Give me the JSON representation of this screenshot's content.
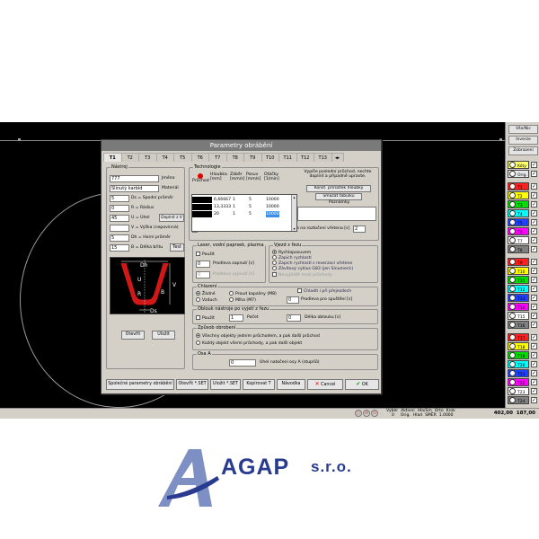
{
  "dialog": {
    "title": "Parametry obrábění",
    "tabs": [
      "T1",
      "T2",
      "T3",
      "T4",
      "T5",
      "T6",
      "T7",
      "T8",
      "T9",
      "T10",
      "T11",
      "T12",
      "T13"
    ],
    "active_tab": "T1"
  },
  "tool": {
    "group_title": "Nástroj",
    "name_value": "777",
    "name_label": "Jméno",
    "material_value": "Slinutý karbid",
    "material_label": "Materiál",
    "ds_value": "5",
    "ds_label": "Ds = Spodní průměr",
    "r_value": "0",
    "r_label": "R = Rádius",
    "u_value": "45",
    "u_label": "U = Úhel",
    "u_button": "Doplnit z V",
    "v_value": "",
    "v_label": "V = Výška (nepovinná)",
    "dh_value": "5",
    "dh_label": "Dh = Horní průměr",
    "b_value": "15",
    "b_label": "B = Délka břitu",
    "test_button": "Test",
    "diagram_labels": [
      "Dh",
      "U",
      "V",
      "R",
      "B",
      "Ds"
    ],
    "open_button": "Otevřít",
    "save_button": "Uložit"
  },
  "technology": {
    "group_title": "Technologie",
    "col_prechod": "Průchod",
    "col_hloubka": "Hloubka [mm]",
    "col_zaber": "Záběr [mm/s]",
    "col_posuv": "Posuv [mm/s]",
    "col_otacky": "Otáčky [1/min]",
    "rows": [
      {
        "hloubka": "6,66667",
        "zaber": "1",
        "posuv": "5",
        "otacky": "10000"
      },
      {
        "hloubka": "13,3333",
        "zaber": "1",
        "posuv": "5",
        "otacky": "10000"
      },
      {
        "hloubka": "20",
        "zaber": "1",
        "posuv": "5",
        "otacky": "10000"
      }
    ],
    "last_pass_text": "Vypíše poslední průchod, nechte doplnit a případně upravte.",
    "construct_button": "Konst. přírůstek hloubky",
    "clear_button": "Smazat tabulku",
    "notes_label": "Poznámky",
    "rapid_depth_value": "0",
    "rapid_depth_label": "Hloubka rychloposuvem",
    "spindle_delay_label": "Prodleva na roztočení vřetena [s]",
    "spindle_delay_value": "2"
  },
  "laser": {
    "group_title": "Laser, vodní paprsek, plazma",
    "use_label": "Použít",
    "on_delay_value": "0",
    "on_delay_label": "Prodleva zapnutí [s]",
    "off_delay_value": "0",
    "off_delay_label": "Prodleva vypnutí [s]"
  },
  "entry": {
    "group_title": "Vjezd z řezu",
    "options": [
      "Rychloposuvem",
      "Zapich rychlostí",
      "Zapich rychlostí s reverzací vřetene",
      "Závitový cyklus G83 (jen Sinumeric)"
    ],
    "selected": "Rychloposuvem",
    "disabled_label": "Nevyjíždět mezi průchody"
  },
  "cooling": {
    "group_title": "Chlazení",
    "options": [
      "Žádné",
      "Proud kapaliny (M8)",
      "Vzduch",
      "Mlha (M7)"
    ],
    "selected": "Žádné",
    "cool_transit_label": "Chladit i při přejezdech",
    "stop_delay_value": "0",
    "stop_delay_label": "Prodleva pro spuštění [s]"
  },
  "arc": {
    "group_title": "Oblouk nástroje po vyjetí z řezu",
    "use_label": "Použít",
    "count_value": "1",
    "count_label": "Počet",
    "length_value": "0",
    "length_label": "Délka oblouku [s]"
  },
  "processing": {
    "group_title": "Způsob obrobení",
    "options": [
      "Všechny objekty jedním průchodem, a pak další průchod",
      "Každý objekt všemi průchody, a pak další objekt"
    ],
    "selected": "Všechny objekty jedním průchodem, a pak další průchod"
  },
  "axis_a": {
    "group_title": "Osa A",
    "value": "0",
    "label": "Úhel natočení osy A (stupňů)"
  },
  "footer": {
    "common_button": "Společné parametry obrábění",
    "open_set_button": "Otevřít *.SET",
    "save_set_button": "Uložit *.SET",
    "copy_button": "Kopírovat T",
    "help_button": "Návodka",
    "cancel_button": "Cancel",
    "ok_button": "OK"
  },
  "right_panel": {
    "all_none": "Vše/Nic",
    "invert": "Inverze",
    "display": "Zobrazení",
    "layers": [
      {
        "label": "Kóty",
        "color": "#ffff66"
      },
      {
        "label": "Orig.",
        "color": "#e8e8e8"
      },
      {
        "label": "T1",
        "color": "#ff2020"
      },
      {
        "label": "T2",
        "color": "#ffff00"
      },
      {
        "label": "T3",
        "color": "#00e000"
      },
      {
        "label": "T4",
        "color": "#00ffff"
      },
      {
        "label": "T5",
        "color": "#2040ff"
      },
      {
        "label": "T6",
        "color": "#ff00ff"
      },
      {
        "label": "T7",
        "color": "#ffffff"
      },
      {
        "label": "T8",
        "color": "#808080"
      },
      {
        "label": "T9",
        "color": "#ff2020"
      },
      {
        "label": "T10",
        "color": "#ffff00"
      },
      {
        "label": "T11",
        "color": "#00e000"
      },
      {
        "label": "T12",
        "color": "#00ffff"
      },
      {
        "label": "T13",
        "color": "#2040ff"
      },
      {
        "label": "T14",
        "color": "#ff00ff"
      },
      {
        "label": "T15",
        "color": "#ffffff"
      },
      {
        "label": "T16",
        "color": "#808080"
      },
      {
        "label": "T17",
        "color": "#ff2020"
      },
      {
        "label": "T18",
        "color": "#ffff00"
      },
      {
        "label": "T19",
        "color": "#00e000"
      },
      {
        "label": "T20",
        "color": "#00ffff"
      },
      {
        "label": "T21",
        "color": "#2040ff"
      },
      {
        "label": "T22",
        "color": "#ff00ff"
      },
      {
        "label": "T23",
        "color": "#ffffff"
      },
      {
        "label": "T24",
        "color": "#808080"
      }
    ]
  },
  "statusbar": {
    "headers": [
      "Výběr",
      "Aktivní",
      "Hla/Sm",
      "Orto",
      "Krok"
    ],
    "values": [
      "0",
      "Orig.",
      "Hlad",
      "SMĚR",
      "1.0000"
    ],
    "x": "402,00",
    "y": "187,00"
  },
  "brand": {
    "name": "AGAP",
    "suffix": "s.r.o.",
    "color": "#283b8e"
  }
}
